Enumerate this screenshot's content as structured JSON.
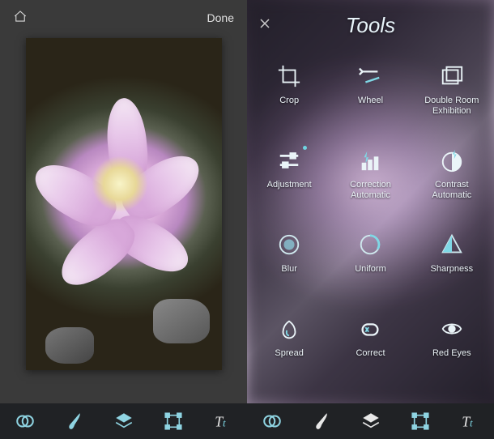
{
  "left": {
    "done_label": "Done"
  },
  "panel": {
    "title": "Tools"
  },
  "tools": [
    {
      "label": "Crop"
    },
    {
      "label": "Wheel"
    },
    {
      "label": "Double Room\nExhibition"
    },
    {
      "label": "Adjustment"
    },
    {
      "label": "Correction\nAutomatic"
    },
    {
      "label": "Contrast\nAutomatic"
    },
    {
      "label": "Blur"
    },
    {
      "label": "Uniform"
    },
    {
      "label": "Sharpness"
    },
    {
      "label": "Spread"
    },
    {
      "label": "Correct"
    },
    {
      "label": "Red Eyes"
    }
  ]
}
